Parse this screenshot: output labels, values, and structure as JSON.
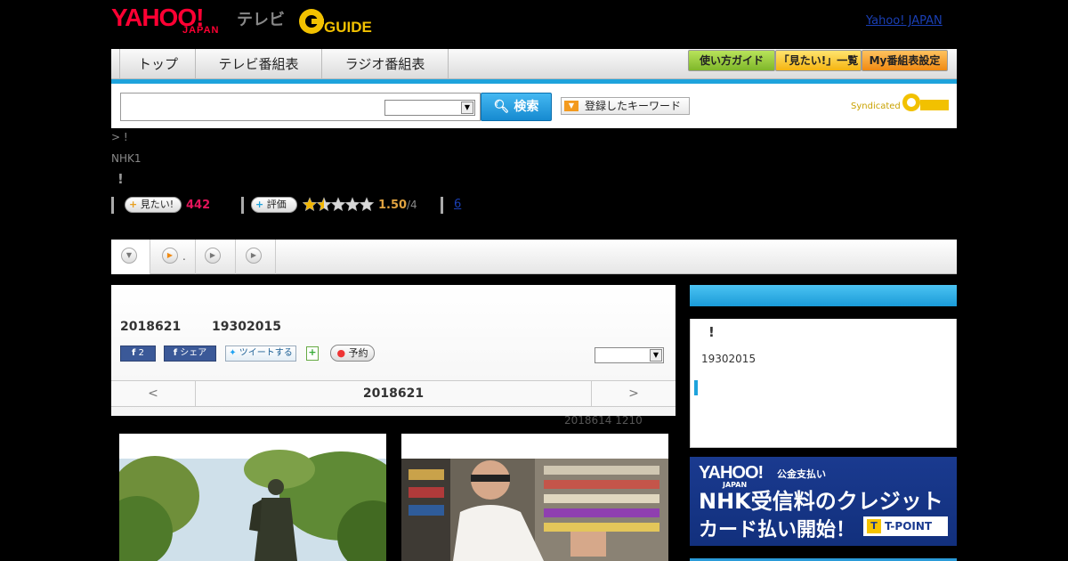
{
  "header": {
    "yahoo_logo": "YAHOO!",
    "yahoo_logo_sub": "JAPAN",
    "tv_label": "テレビ",
    "gguide_logo": "GUIDE",
    "top_link": "Yahoo! JAPAN"
  },
  "nav": {
    "tabs": [
      "トップ",
      "テレビ番組表",
      "ラジオ番組表"
    ],
    "buttons": [
      "使い方ガイド",
      "「見たい!」一覧",
      "My番組表設定"
    ]
  },
  "search": {
    "input_value": "",
    "select_value": "",
    "button_label": "検索",
    "keyword_button": "登録したキーワード",
    "syndicated": "Syndicated"
  },
  "program": {
    "breadcrumb": "> !",
    "channel": "NHK1",
    "title": "!",
    "want_label": "見たい!",
    "want_count": "442",
    "rate_label": "評価",
    "rating": 1.5,
    "rating_value": "1.50",
    "rating_max": "/4",
    "review_count": "6"
  },
  "tabstrip": {
    "tab2_suffix": "."
  },
  "detail": {
    "date": "2018621",
    "time": "19302015",
    "fb_count": "2",
    "fb_share": "シェア",
    "tweet": "ツイートする",
    "reserve": "予約",
    "panel_select": "",
    "prev": "<",
    "current_day": "2018621",
    "next": ">",
    "updated": "2018614  1210"
  },
  "side": {
    "mark": "!",
    "time": "19302015"
  },
  "banner": {
    "brand": "YAHOO!",
    "brand_sub": "公金支払い",
    "brand_japan": "JAPAN",
    "line1": "NHK受信料のクレジット",
    "line2": "カード払い開始！",
    "tpoint": "T-POINT",
    "tpoint_mark": "T"
  },
  "colors": {
    "accent_blue": "#1ea3dc",
    "want_pink": "#e4145a",
    "rating_orange": "#e1a340",
    "link_blue": "#1a3fb5"
  }
}
